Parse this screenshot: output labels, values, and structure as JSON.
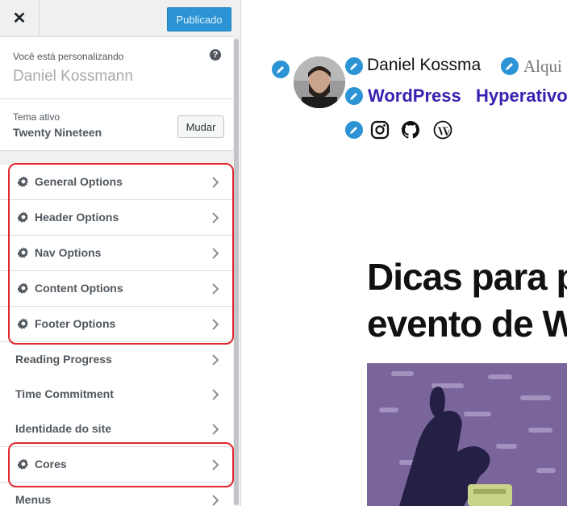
{
  "topbar": {
    "close_label": "✕",
    "publish_label": "Publicado"
  },
  "info": {
    "customizing_label": "Você está personalizando",
    "site_name": "Daniel Kossmann",
    "help_label": "?"
  },
  "theme": {
    "label": "Tema ativo",
    "name": "Twenty Nineteen",
    "change_label": "Mudar"
  },
  "menu": {
    "options": [
      {
        "label": "General Options"
      },
      {
        "label": "Header Options"
      },
      {
        "label": "Nav Options"
      },
      {
        "label": "Content Options"
      },
      {
        "label": "Footer Options"
      }
    ],
    "items": [
      {
        "label": "Reading Progress"
      },
      {
        "label": "Time Commitment"
      },
      {
        "label": "Identidade do site"
      }
    ],
    "cores_label": "Cores",
    "menus_label": "Menus"
  },
  "preview": {
    "site_name": "Daniel Kossma",
    "tagline": "Alqui",
    "nav": [
      "WordPress",
      "Hyperativo"
    ],
    "social_icons": [
      "instagram-icon",
      "github-icon",
      "wordpress-icon"
    ],
    "post_title_line1": "Dicas para p",
    "post_title_line2": "evento de W"
  },
  "colors": {
    "accent": "#2c94d4",
    "highlight": "#e0282e",
    "nav_link": "#3a1fb0"
  }
}
